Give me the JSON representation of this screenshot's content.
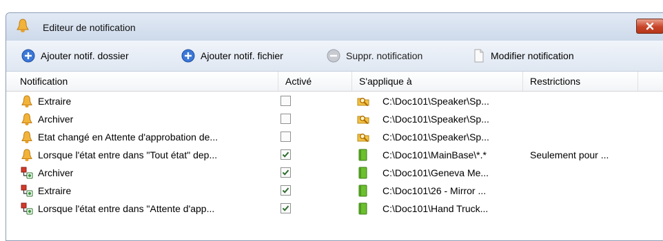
{
  "window": {
    "title": "Editeur de notification",
    "title_icon": "bell-icon",
    "close_icon": "close-icon"
  },
  "toolbar": {
    "add_folder_label": "Ajouter notif. dossier",
    "add_file_label": "Ajouter notif. fichier",
    "delete_label": "Suppr. notification",
    "edit_label": "Modifier notification",
    "add_icon": "plus-circle-icon",
    "delete_icon": "minus-circle-icon",
    "edit_icon": "document-icon"
  },
  "table": {
    "columns": [
      "Notification",
      "Activé",
      "S'applique à",
      "Restrictions"
    ],
    "rows": [
      {
        "icon": "bell-icon",
        "notification": "Extraire",
        "active": false,
        "target_icon": "folder-search-icon",
        "applies_to": "C:\\Doc101\\Speaker\\Sp...",
        "restrictions": ""
      },
      {
        "icon": "bell-icon",
        "notification": "Archiver",
        "active": false,
        "target_icon": "folder-search-icon",
        "applies_to": "C:\\Doc101\\Speaker\\Sp...",
        "restrictions": ""
      },
      {
        "icon": "bell-icon",
        "notification": "Etat changé en Attente d'approbation de...",
        "active": false,
        "target_icon": "folder-search-icon",
        "applies_to": "C:\\Doc101\\Speaker\\Sp...",
        "restrictions": ""
      },
      {
        "icon": "bell-icon",
        "notification": "Lorsque l'état entre dans \"Tout état\" dep...",
        "active": true,
        "target_icon": "book-icon",
        "applies_to": "C:\\Doc101\\MainBase\\*.*",
        "restrictions": "Seulement pour ..."
      },
      {
        "icon": "workflow-icon",
        "notification": "Archiver",
        "active": true,
        "target_icon": "book-icon",
        "applies_to": "C:\\Doc101\\Geneva Me...",
        "restrictions": ""
      },
      {
        "icon": "workflow-icon",
        "notification": "Extraire",
        "active": true,
        "target_icon": "book-icon",
        "applies_to": "C:\\Doc101\\26 - Mirror ...",
        "restrictions": ""
      },
      {
        "icon": "workflow-icon",
        "notification": "Lorsque l'état entre dans \"Attente d'app...",
        "active": true,
        "target_icon": "book-icon",
        "applies_to": "C:\\Doc101\\Hand Truck...",
        "restrictions": ""
      }
    ]
  },
  "colors": {
    "bell": "#f2b33a",
    "book": "#6cbf2e",
    "check": "#2f6d2f",
    "add": "#3b78d8",
    "delete": "#b8bcc4"
  }
}
